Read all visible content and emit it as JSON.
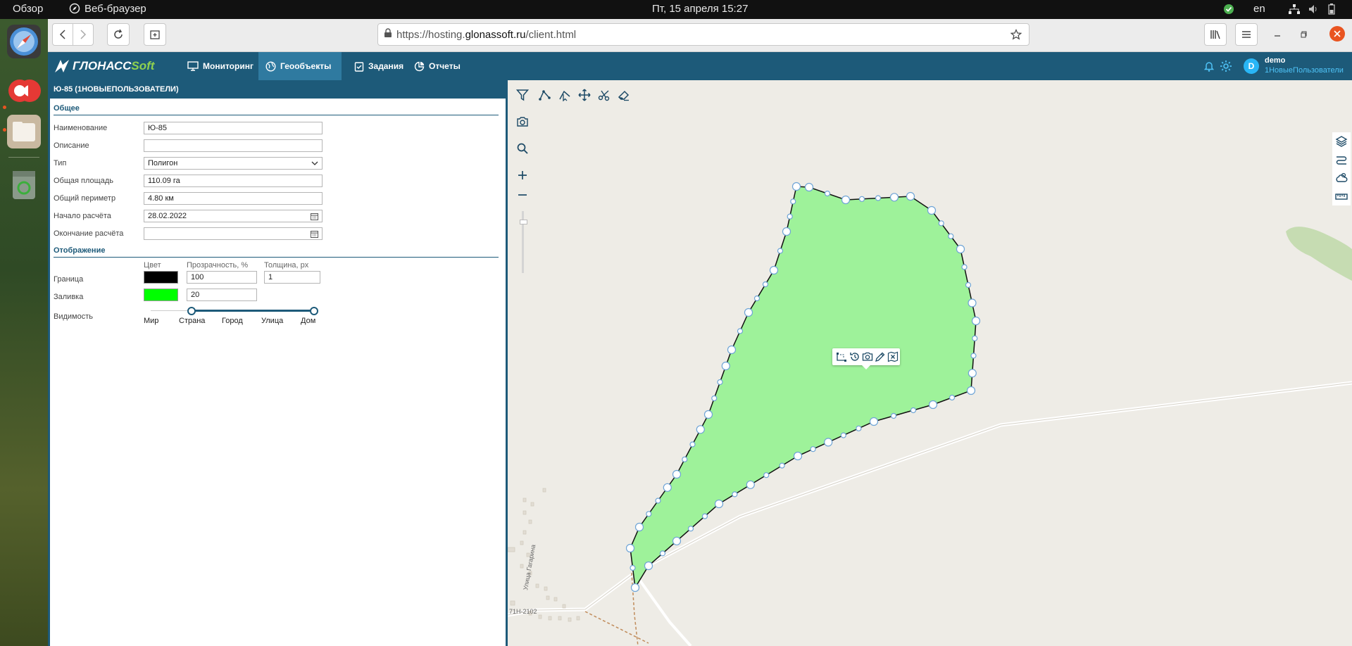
{
  "system": {
    "overview": "Обзор",
    "browser_app": "Веб-браузер",
    "clock": "Пт, 15 апреля  15:27",
    "lang": "en"
  },
  "browser": {
    "url_prefix": "https://hosting.",
    "url_domain": "glonassoft.ru",
    "url_suffix": "/client.html"
  },
  "header": {
    "logo_main": "ГЛОНАСС",
    "logo_soft": "Soft",
    "nav": [
      {
        "label": "Мониторинг",
        "icon": "monitor-icon"
      },
      {
        "label": "Геообъекты",
        "icon": "globe-icon"
      },
      {
        "label": "Задания",
        "icon": "tasks-icon"
      },
      {
        "label": "Отчеты",
        "icon": "chart-icon"
      }
    ],
    "user_initial": "D",
    "user_name": "demo",
    "user_group": "1НовыеПользователи"
  },
  "panel": {
    "title": "Ю-85 (1НОВЫЕПОЛЬЗОВАТЕЛИ)",
    "section_general": "Общее",
    "name_label": "Наименование",
    "name_value": "Ю-85",
    "desc_label": "Описание",
    "desc_value": "",
    "type_label": "Тип",
    "type_value": "Полигон",
    "area_label": "Общая площадь",
    "area_value": "110.09 га",
    "perimeter_label": "Общий периметр",
    "perimeter_value": "4.80 км",
    "start_label": "Начало расчёта",
    "start_value": "28.02.2022",
    "end_label": "Окончание расчёта",
    "end_value": "",
    "section_display": "Отображение",
    "col_color": "Цвет",
    "col_opacity": "Прозрачность, %",
    "col_thickness": "Толщина, px",
    "border_label": "Граница",
    "border_color": "#000000",
    "border_opacity": "100",
    "border_thickness": "1",
    "fill_label": "Заливка",
    "fill_color": "#00ff00",
    "fill_opacity": "20",
    "visibility_label": "Видимость",
    "scale": [
      "Мир",
      "Страна",
      "Город",
      "Улица",
      "Дом"
    ],
    "visibility_from": 1,
    "visibility_to": 4
  },
  "map": {
    "road_label_1": "Улица Гагарина",
    "road_label_2": "71Н-2102",
    "polygon_fill": "#9ef29a"
  }
}
